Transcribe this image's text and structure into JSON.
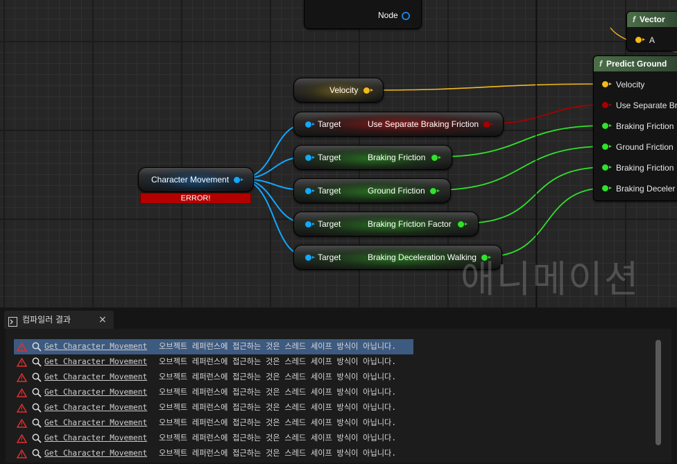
{
  "graph": {
    "partial_node_label": "Node",
    "velocity_node": {
      "label": "Velocity"
    },
    "character_movement_node": {
      "label": "Character Movement",
      "error": "ERROR!"
    },
    "getter_nodes": [
      {
        "target": "Target",
        "label": "Use Separate Braking Friction",
        "type": "bool"
      },
      {
        "target": "Target",
        "label": "Braking Friction",
        "type": "float"
      },
      {
        "target": "Target",
        "label": "Ground Friction",
        "type": "float"
      },
      {
        "target": "Target",
        "label": "Braking Friction Factor",
        "type": "float"
      },
      {
        "target": "Target",
        "label": "Braking Deceleration Walking",
        "type": "float"
      }
    ],
    "vector_node": {
      "icon": "f",
      "title": "Vector",
      "pin_a": "A"
    },
    "predict_node": {
      "icon": "f",
      "title": "Predict Ground",
      "pins": [
        "Velocity",
        "Use Separate Br",
        "Braking Friction",
        "Ground Friction",
        "Braking Friction",
        "Braking Deceler"
      ]
    },
    "watermark": "애니메이션",
    "colors": {
      "object": "#12a8ff",
      "vector": "#f4b91c",
      "float": "#2fe329",
      "bool": "#a80000",
      "error": "#b30000"
    }
  },
  "panel": {
    "tab_label": "컴파일러 결과",
    "tab_close": "×",
    "messages": [
      {
        "link": "Get Character Movement",
        "text": "오브젝트 레퍼런스에 접근하는 것은 스레드 세이프 방식이 아닙니다."
      },
      {
        "link": "Get Character Movement",
        "text": "오브젝트 레퍼런스에 접근하는 것은 스레드 세이프 방식이 아닙니다."
      },
      {
        "link": "Get Character Movement",
        "text": "오브젝트 레퍼런스에 접근하는 것은 스레드 세이프 방식이 아닙니다."
      },
      {
        "link": "Get Character Movement",
        "text": "오브젝트 레퍼런스에 접근하는 것은 스레드 세이프 방식이 아닙니다."
      },
      {
        "link": "Get Character Movement",
        "text": "오브젝트 레퍼런스에 접근하는 것은 스레드 세이프 방식이 아닙니다."
      },
      {
        "link": "Get Character Movement",
        "text": "오브젝트 레퍼런스에 접근하는 것은 스레드 세이프 방식이 아닙니다."
      },
      {
        "link": "Get Character Movement",
        "text": "오브젝트 레퍼런스에 접근하는 것은 스레드 세이프 방식이 아닙니다."
      },
      {
        "link": "Get Character Movement",
        "text": "오브젝트 레퍼런스에 접근하는 것은 스레드 세이프 방식이 아닙니다."
      }
    ]
  }
}
